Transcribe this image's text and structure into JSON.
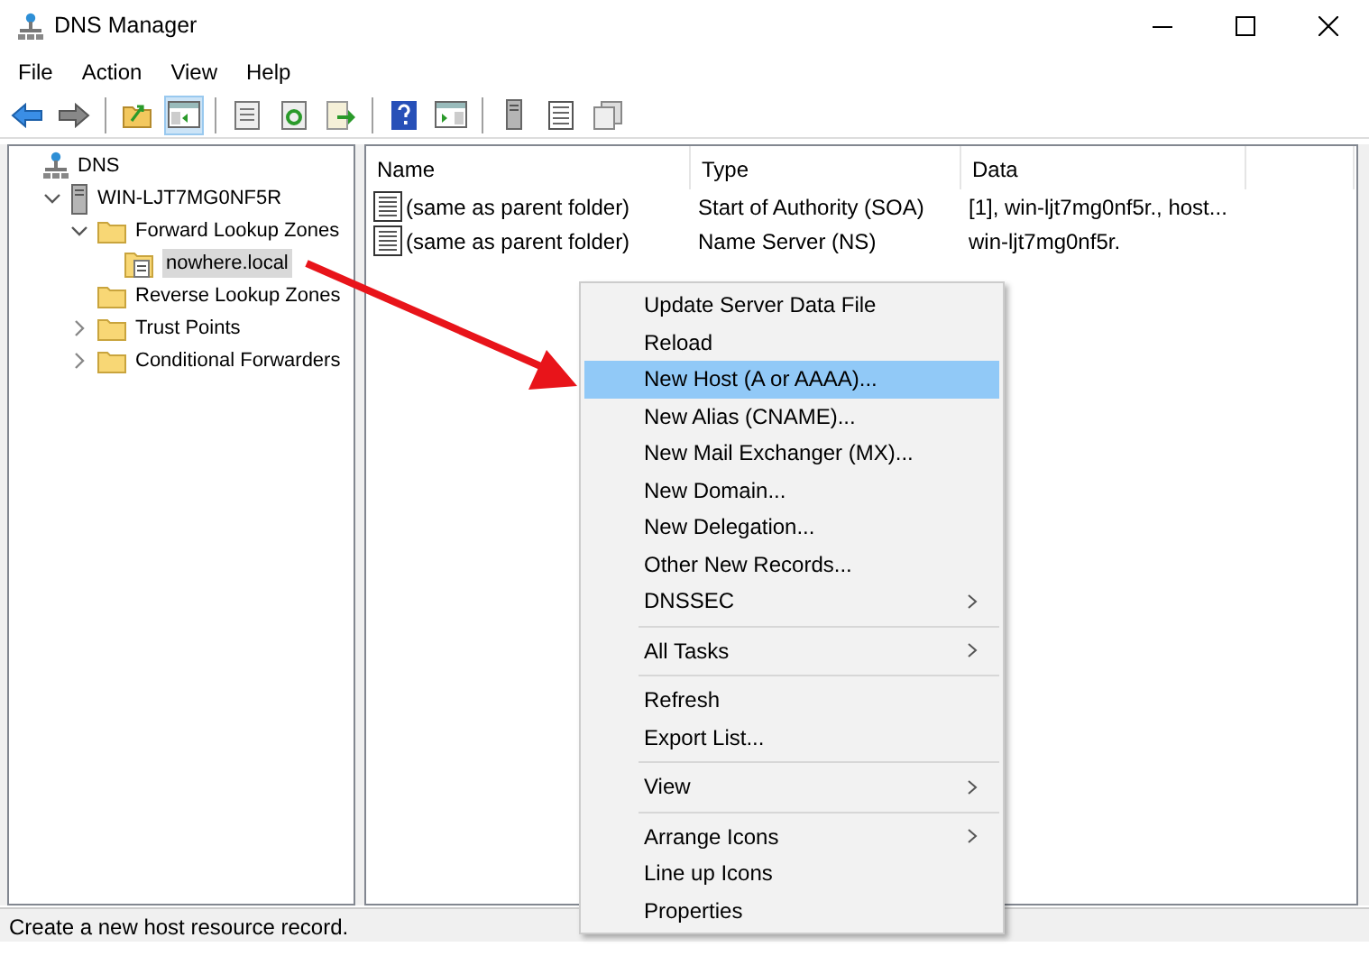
{
  "window": {
    "title": "DNS Manager"
  },
  "menu": [
    "File",
    "Action",
    "View",
    "Help"
  ],
  "toolbar": [
    {
      "selected": false
    },
    {
      "selected": false
    },
    {
      "selected": false
    },
    {
      "selected": true
    },
    {
      "selected": false
    },
    {
      "selected": false
    },
    {
      "selected": false
    },
    {
      "selected": false
    },
    {
      "selected": false
    },
    {
      "selected": false
    },
    {
      "selected": false
    },
    {
      "selected": false
    }
  ],
  "tree": [
    {
      "label": "DNS",
      "selected": false,
      "children": [
        {
          "label": "WIN-LJT7MG0NF5R",
          "selected": false,
          "expanded": true,
          "children": [
            {
              "label": "Forward Lookup Zones",
              "selected": false,
              "expanded": true,
              "children": [
                {
                  "label": "nowhere.local",
                  "selected": true
                }
              ]
            },
            {
              "label": "Reverse Lookup Zones",
              "selected": false
            },
            {
              "label": "Trust Points",
              "selected": false,
              "expanded": false
            },
            {
              "label": "Conditional Forwarders",
              "selected": false,
              "expanded": false
            }
          ]
        }
      ]
    }
  ],
  "table": {
    "columns": [
      "Name",
      "Type",
      "Data"
    ],
    "rows": [
      {
        "name": "(same as parent folder)",
        "type": "Start of Authority (SOA)",
        "data": "[1], win-ljt7mg0nf5r., host..."
      },
      {
        "name": "(same as parent folder)",
        "type": "Name Server (NS)",
        "data": "win-ljt7mg0nf5r."
      }
    ]
  },
  "context_menu": [
    {
      "label": "Update Server Data File",
      "selected": false
    },
    {
      "label": "Reload",
      "selected": false
    },
    {
      "label": "New Host (A or AAAA)...",
      "selected": true
    },
    {
      "label": "New Alias (CNAME)...",
      "selected": false
    },
    {
      "label": "New Mail Exchanger (MX)...",
      "selected": false
    },
    {
      "label": "New Domain...",
      "selected": false
    },
    {
      "label": "New Delegation...",
      "selected": false
    },
    {
      "label": "Other New Records...",
      "selected": false
    },
    {
      "label": "DNSSEC",
      "selected": false,
      "submenu": true
    },
    {
      "label": "All Tasks",
      "selected": false,
      "submenu": true,
      "separator_before": true
    },
    {
      "label": "Refresh",
      "selected": false,
      "separator_before": true
    },
    {
      "label": "Export List...",
      "selected": false
    },
    {
      "label": "View",
      "selected": false,
      "submenu": true,
      "separator_before": true
    },
    {
      "label": "Arrange Icons",
      "selected": false,
      "submenu": true,
      "separator_before": true
    },
    {
      "label": "Line up Icons",
      "selected": false
    },
    {
      "label": "Properties",
      "selected": false
    }
  ],
  "status_bar": "Create a new host resource record."
}
